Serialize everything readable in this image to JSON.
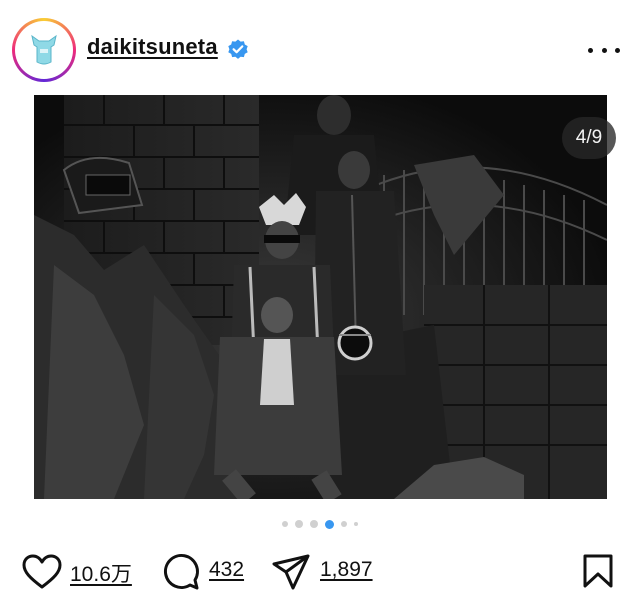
{
  "post": {
    "username": "daikitsuneta",
    "verified": true,
    "image_counter": "4/9",
    "carousel": {
      "total_dots": 6,
      "active_index": 3
    }
  },
  "actions": {
    "likes": "10.6万",
    "comments": "432",
    "shares": "1,897"
  },
  "colors": {
    "verified_badge": "#3897f0",
    "active_dot": "#3897f0",
    "text": "#111111"
  },
  "icons": [
    "avatar-logo-icon",
    "verified-badge-icon",
    "more-options-icon",
    "heart-icon",
    "comment-icon",
    "share-icon",
    "bookmark-icon"
  ]
}
